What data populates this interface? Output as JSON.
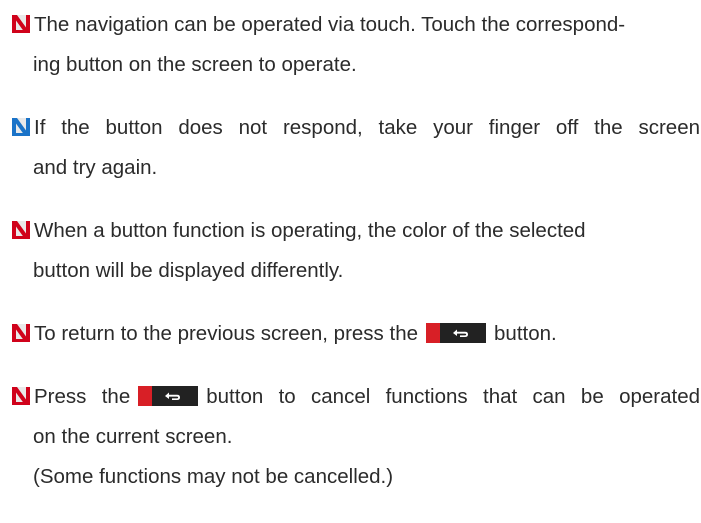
{
  "colors": {
    "marker_red": "#d0021b",
    "marker_blue": "#1a73c8",
    "marker_bg": "#e9e9e9",
    "button_red": "#d81f26",
    "button_dark": "#1a1a1a",
    "text": "#2b2b2b"
  },
  "notes": [
    {
      "marker": "red",
      "lines": [
        "The navigation can be operated via touch. Touch the correspond-",
        "ing button on the screen to operate."
      ]
    },
    {
      "marker": "blue",
      "lines": [
        "If the button does not respond, take your finger off the screen",
        "and try again."
      ]
    },
    {
      "marker": "red",
      "lines": [
        "When a button function is operating, the color of the selected",
        "button will be displayed differently."
      ]
    },
    {
      "marker": "red",
      "before_icon": "To return to the previous screen, press the",
      "icon": "back-button-icon",
      "after_icon": "button."
    },
    {
      "marker": "red",
      "before_icon": "Press the",
      "icon": "back-button-icon",
      "after_icon": "button to cancel functions that can be operated",
      "lines": [
        "on the current screen.",
        "(Some functions may not be cancelled.)"
      ]
    }
  ]
}
